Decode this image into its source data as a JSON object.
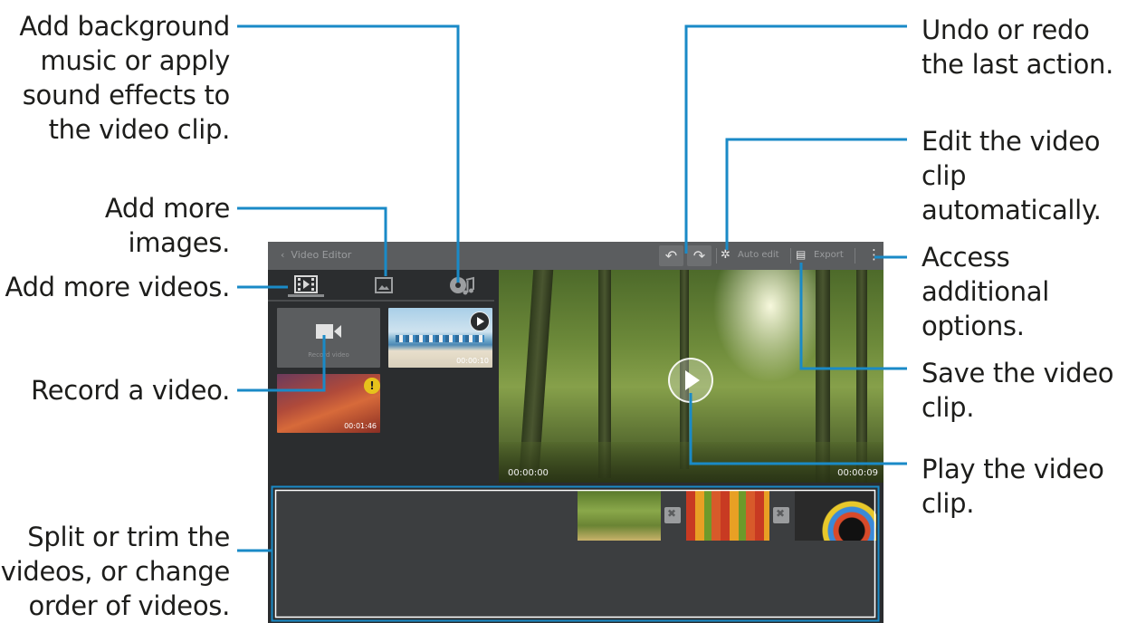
{
  "callouts": {
    "music": "Add background music or apply sound effects to the video clip.",
    "images": "Add more images.",
    "videos": "Add more videos.",
    "record": "Record a video.",
    "split": "Split or trim the videos, or change order of videos.",
    "undo": "Undo or redo the last action.",
    "auto_edit": "Edit the video clip automatically.",
    "options": "Access additional options.",
    "save": "Save the video clip.",
    "play": "Play the video clip."
  },
  "app": {
    "title": "Video Editor",
    "auto_edit_label": "Auto edit",
    "export_label": "Export"
  },
  "library": {
    "record_label": "Record video",
    "clip1_duration": "00:00:10",
    "clip2_duration": "00:01:46"
  },
  "preview": {
    "time_start": "00:00:00",
    "time_end": "00:00:09"
  },
  "colors": {
    "callout_line": "#1a8ac7",
    "action_bar": "#5b5d5f",
    "panel": "#2b2d2f"
  },
  "icons": [
    "back-icon",
    "undo-icon",
    "redo-icon",
    "auto-edit-icon",
    "export-icon",
    "overflow-menu-icon",
    "video-tab-icon",
    "image-tab-icon",
    "music-tab-icon",
    "camera-icon",
    "play-icon",
    "warning-icon"
  ]
}
